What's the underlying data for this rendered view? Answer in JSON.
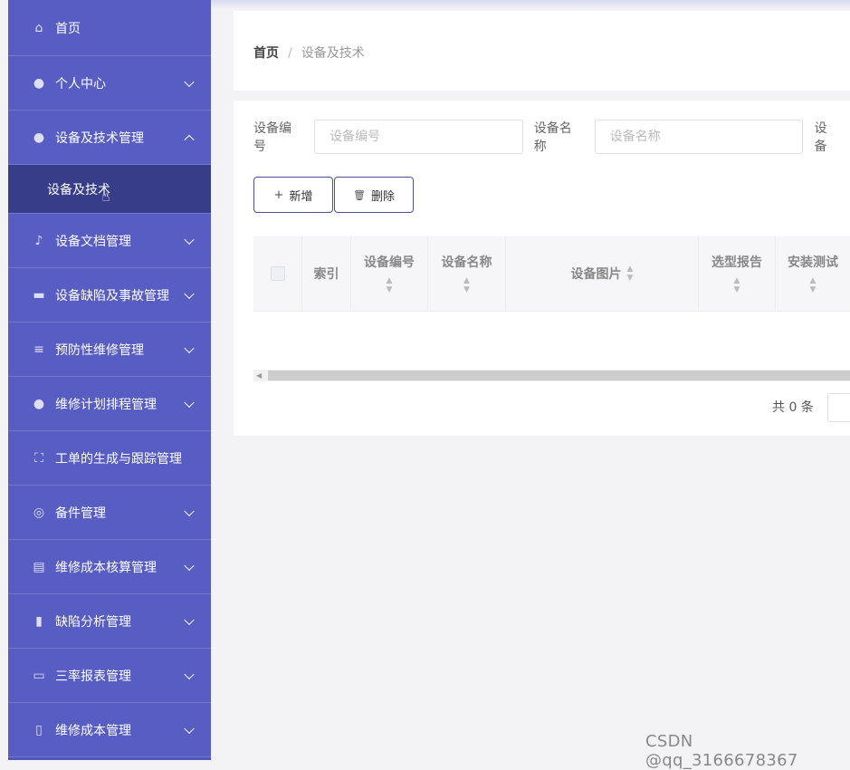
{
  "sidebar": {
    "items": [
      {
        "label": "首页",
        "icon": "home-icon",
        "glyph": "⌂",
        "chevron": "none"
      },
      {
        "label": "个人中心",
        "icon": "user-icon",
        "glyph": "●",
        "chevron": "down"
      },
      {
        "label": "设备及技术管理",
        "icon": "user-icon",
        "glyph": "●",
        "chevron": "up",
        "children": [
          {
            "label": "设备及技术"
          }
        ]
      },
      {
        "label": "设备文档管理",
        "icon": "microphone-icon",
        "glyph": "♪",
        "chevron": "down"
      },
      {
        "label": "设备缺陷及事故管理",
        "icon": "chat-icon",
        "glyph": "▬",
        "chevron": "down"
      },
      {
        "label": "预防性维修管理",
        "icon": "menu-lines-icon",
        "glyph": "≡",
        "chevron": "down"
      },
      {
        "label": "维修计划排程管理",
        "icon": "lightbulb-icon",
        "glyph": "●",
        "chevron": "down"
      },
      {
        "label": "工单的生成与跟踪管理",
        "icon": "fullscreen-icon",
        "glyph": "⛶",
        "chevron": "none"
      },
      {
        "label": "备件管理",
        "icon": "lifebuoy-icon",
        "glyph": "◎",
        "chevron": "down"
      },
      {
        "label": "维修成本核算管理",
        "icon": "clipboard-icon",
        "glyph": "▤",
        "chevron": "down"
      },
      {
        "label": "缺陷分析管理",
        "icon": "book-icon",
        "glyph": "▮",
        "chevron": "down"
      },
      {
        "label": "三率报表管理",
        "icon": "monitor-icon",
        "glyph": "▭",
        "chevron": "down"
      },
      {
        "label": "维修成本管理",
        "icon": "phone-icon",
        "glyph": "▯",
        "chevron": "down"
      }
    ]
  },
  "breadcrumb": {
    "home": "首页",
    "sep": "/",
    "current": "设备及技术"
  },
  "search": {
    "field1_label": "设备编号",
    "field1_placeholder": "设备编号",
    "field2_label": "设备名称",
    "field2_placeholder": "设备名称",
    "field3_label": "设备"
  },
  "actions": {
    "add_label": "新增",
    "add_icon": "+",
    "delete_label": "删除",
    "delete_icon": "🗑"
  },
  "table": {
    "columns": [
      "索引",
      "设备编号",
      "设备名称",
      "设备图片",
      "选型报告",
      "安装测试"
    ],
    "sort_icon": "▲\n▼"
  },
  "pagination": {
    "total_text": "共 0 条"
  },
  "watermark": "CSDN @qq_3166678367"
}
